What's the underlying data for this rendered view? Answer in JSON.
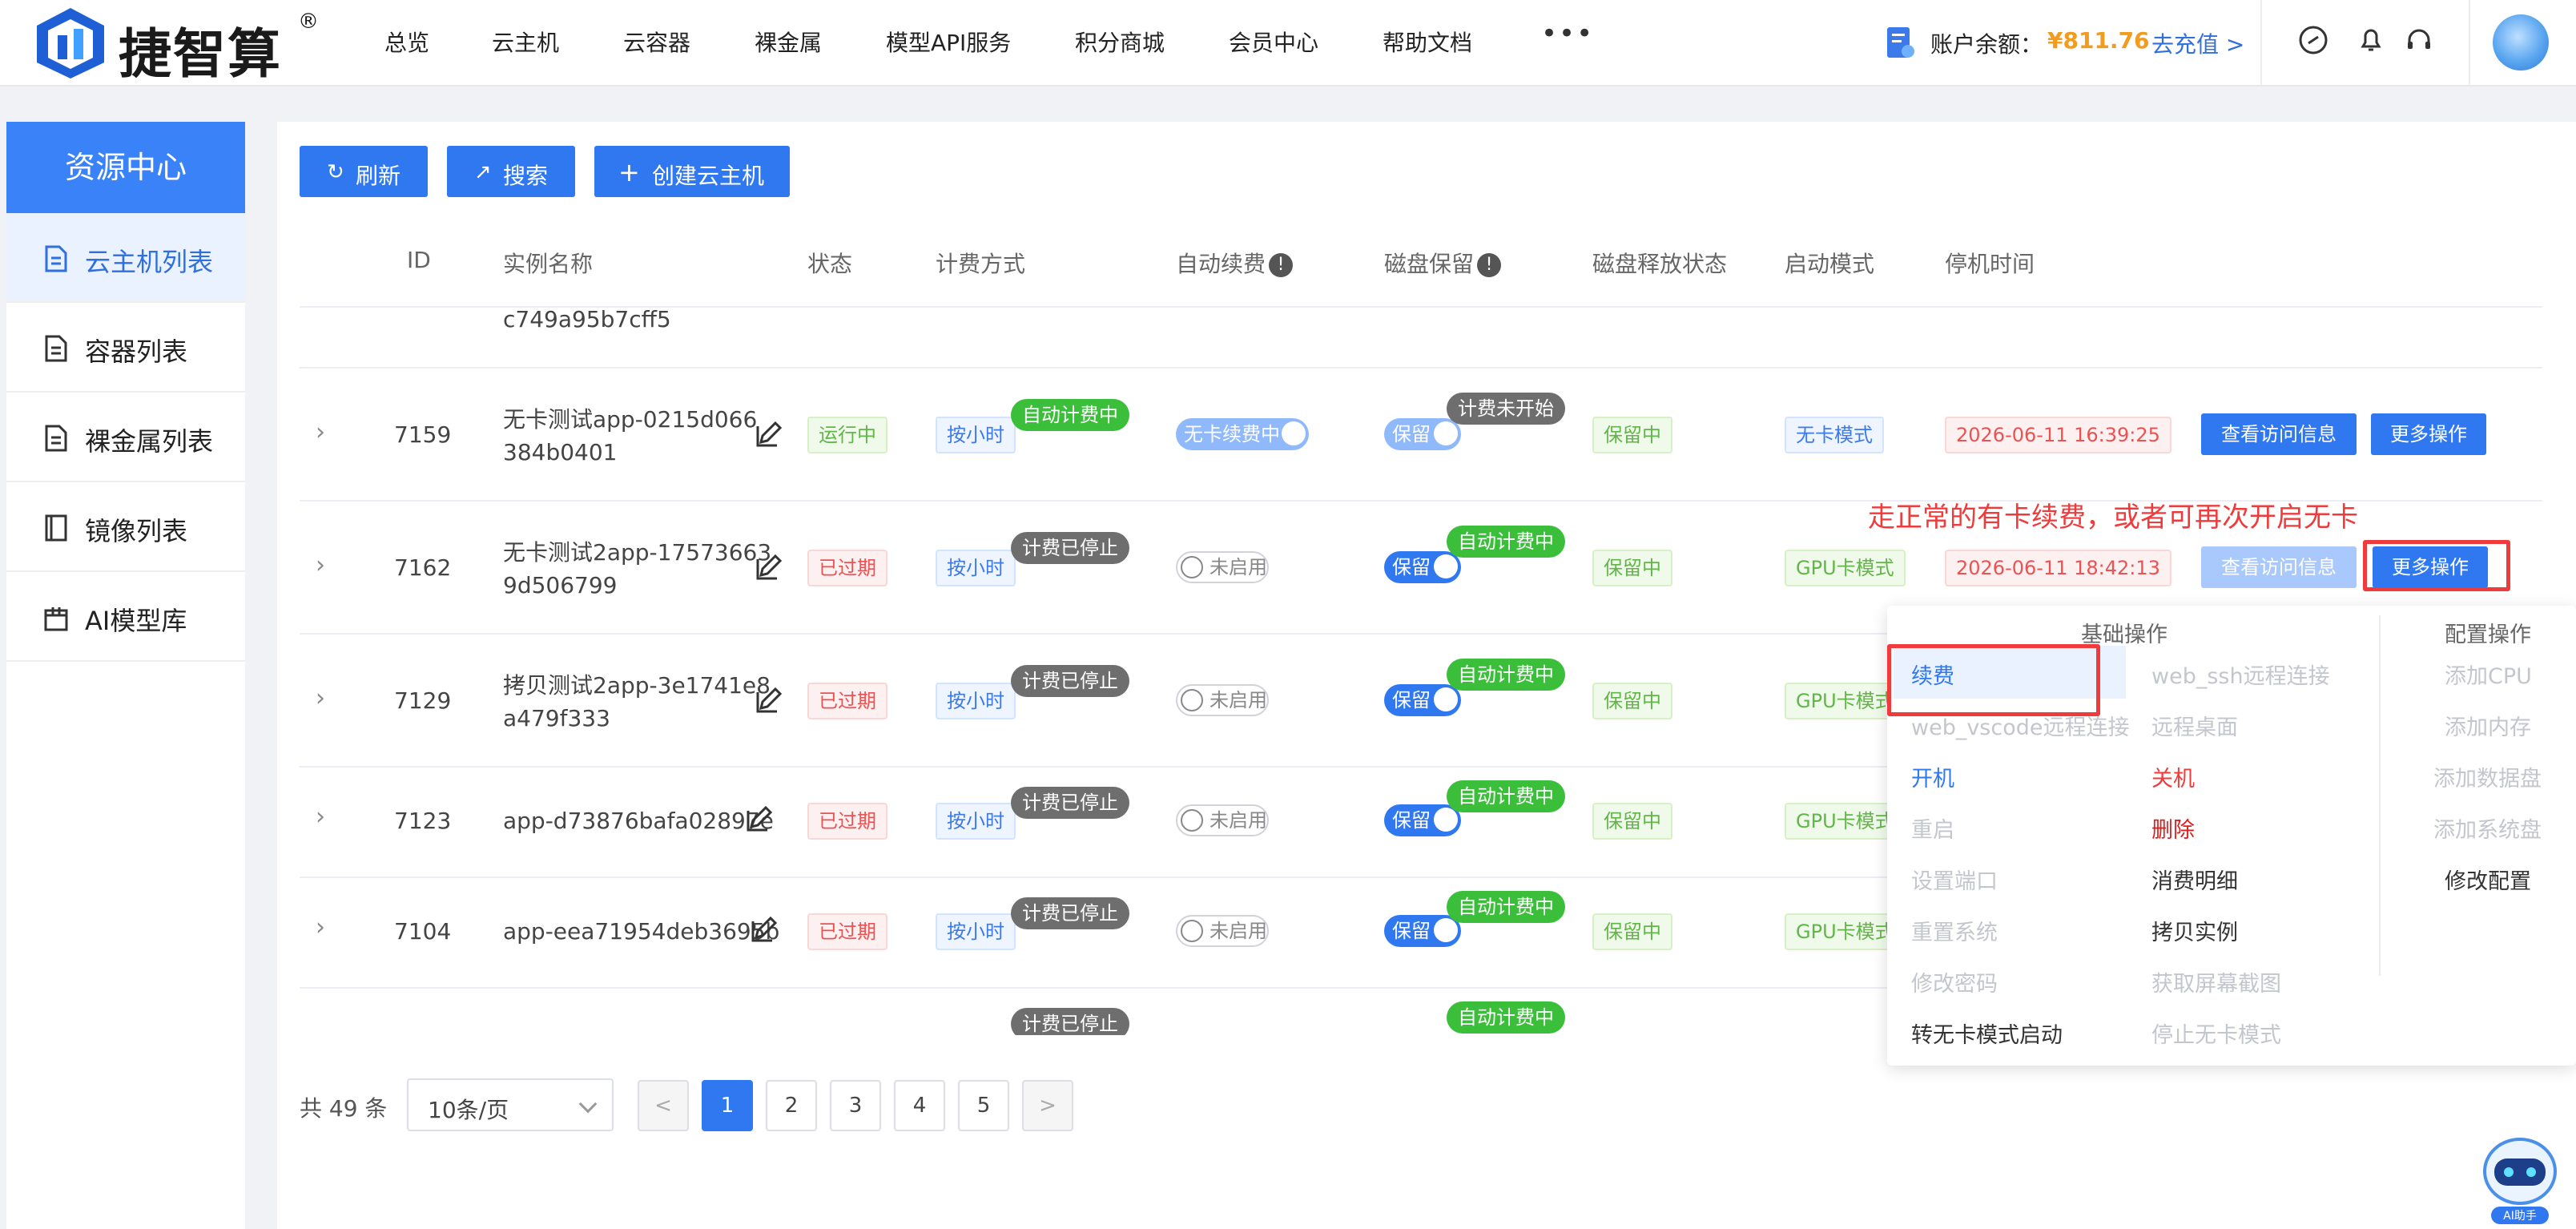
{
  "brand": {
    "name": "捷智算",
    "reg": "®"
  },
  "nav": {
    "items": [
      "总览",
      "云主机",
      "云容器",
      "裸金属",
      "模型API服务",
      "积分商城",
      "会员中心",
      "帮助文档"
    ],
    "more": "•••"
  },
  "account": {
    "balance_label": "账户余额：",
    "balance_value": "¥811.76",
    "recharge": "去充值 >"
  },
  "sidebar": {
    "title": "资源中心",
    "items": [
      "云主机列表",
      "容器列表",
      "裸金属列表",
      "镜像列表",
      "AI模型库"
    ]
  },
  "toolbar": {
    "refresh": "刷新",
    "search": "搜索",
    "create": "创建云主机"
  },
  "table": {
    "headers": [
      "ID",
      "实例名称",
      "状态",
      "计费方式",
      "自动续费",
      "磁盘保留",
      "磁盘释放状态",
      "启动模式",
      "停机时间"
    ],
    "partial_top": {
      "name": "c749a95b7cff5"
    },
    "rows": [
      {
        "id": "7159",
        "name1": "无卡测试app-0215d066",
        "name2": "384b0401",
        "status": "运行中",
        "billing": "按小时",
        "billing_bubble": "自动计费中",
        "auto_renew": "无卡续费中",
        "disk_keep": "保留",
        "disk_bubble": "计费未开始",
        "disk_release": "保留中",
        "boot_mode": "无卡模式",
        "stop_time": "2026-06-11 16:39:25"
      },
      {
        "id": "7162",
        "name1": "无卡测试2app-17573663",
        "name2": "9d506799",
        "status": "已过期",
        "billing": "按小时",
        "billing_bubble": "计费已停止",
        "auto_renew": "未启用",
        "disk_keep": "保留",
        "disk_bubble": "自动计费中",
        "disk_release": "保留中",
        "boot_mode": "GPU卡模式",
        "stop_time": "2026-06-11 18:42:13"
      },
      {
        "id": "7129",
        "name1": "拷贝测试2app-3e1741e8",
        "name2": "a479f333",
        "status": "已过期",
        "billing": "按小时",
        "billing_bubble": "计费已停止",
        "auto_renew": "未启用",
        "disk_keep": "保留",
        "disk_bubble": "自动计费中",
        "disk_release": "保留中",
        "boot_mode": "GPU卡模式"
      },
      {
        "id": "7123",
        "name1": "app-d73876bafa02897e",
        "status": "已过期",
        "billing": "按小时",
        "billing_bubble": "计费已停止",
        "auto_renew": "未启用",
        "disk_keep": "保留",
        "disk_bubble": "自动计费中",
        "disk_release": "保留中",
        "boot_mode": "GPU卡模式"
      },
      {
        "id": "7104",
        "name1": "app-eea71954deb3695b",
        "status": "已过期",
        "billing": "按小时",
        "billing_bubble": "计费已停止",
        "auto_renew": "未启用",
        "disk_keep": "保留",
        "disk_bubble": "自动计费中",
        "disk_release": "保留中",
        "boot_mode": "GPU卡模式"
      }
    ],
    "partial_bottom": {
      "billing_bubble": "计费已停止",
      "disk_bubble": "自动计费中"
    },
    "actions": {
      "view": "查看访问信息",
      "more": "更多操作"
    }
  },
  "annotation": "走正常的有卡续费，或者可再次开启无卡",
  "menu": {
    "basic_title": "基础操作",
    "config_title": "配置操作",
    "col1": [
      "续费",
      "web_vscode远程连接",
      "开机",
      "重启",
      "设置端口",
      "重置系统",
      "修改密码",
      "转无卡模式启动"
    ],
    "col2": [
      "web_ssh远程连接",
      "远程桌面",
      "关机",
      "删除",
      "消费明细",
      "拷贝实例",
      "获取屏幕截图",
      "停止无卡模式"
    ],
    "col3": [
      "添加CPU",
      "添加内存",
      "添加数据盘",
      "添加系统盘",
      "修改配置"
    ]
  },
  "pagination": {
    "total": "共 49 条",
    "page_size": "10条/页",
    "pages": [
      "1",
      "2",
      "3",
      "4",
      "5"
    ],
    "prev": "<",
    "next": ">"
  },
  "assistant": {
    "label": "AI助手"
  }
}
